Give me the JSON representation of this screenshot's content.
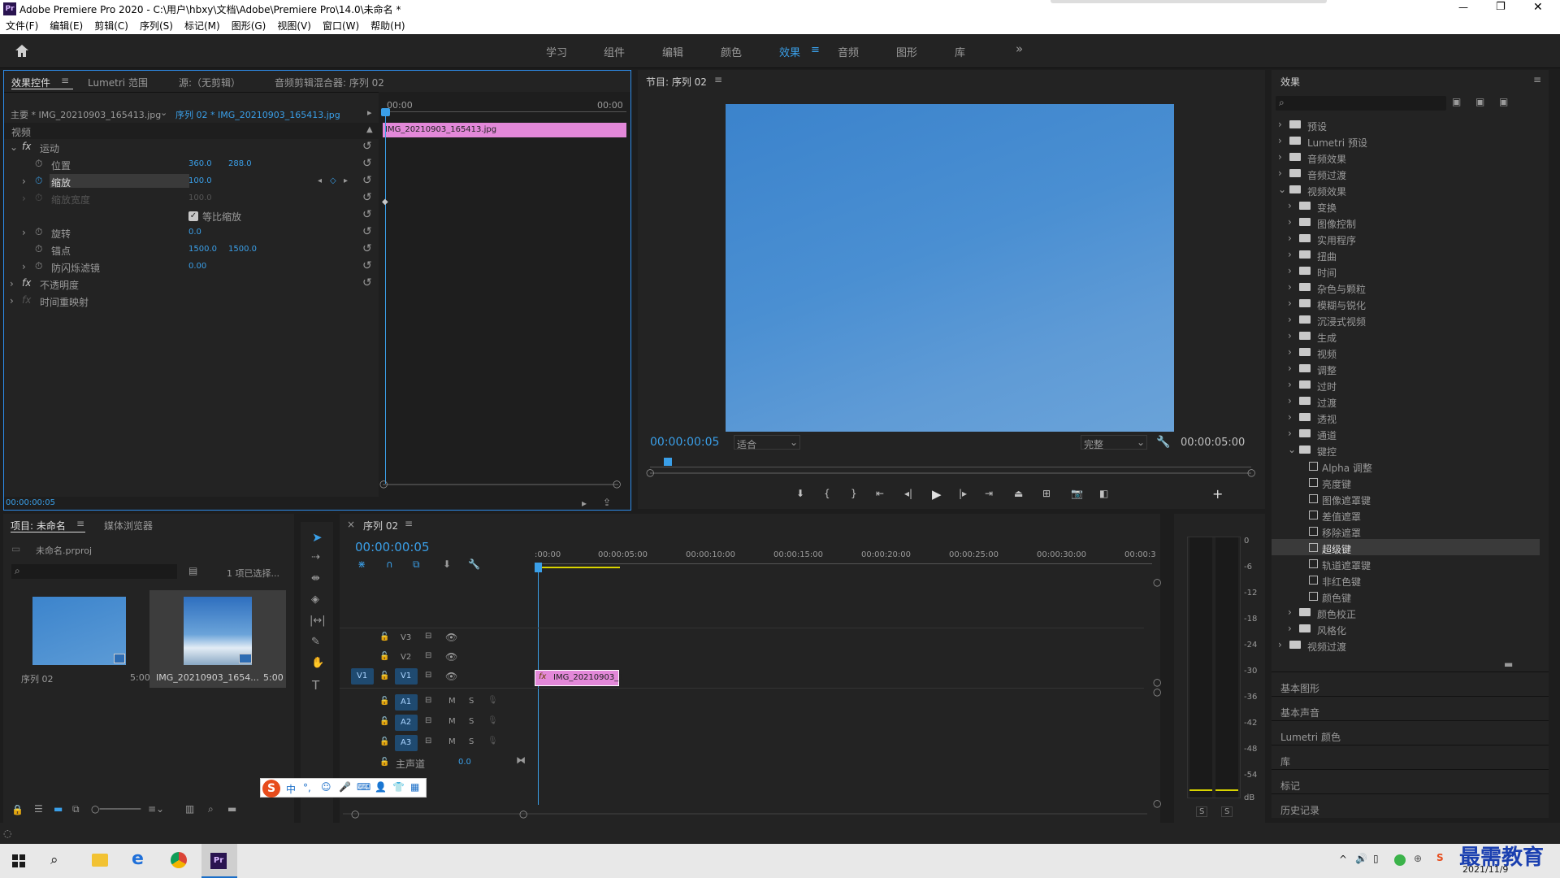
{
  "window": {
    "app_icon": "Pr",
    "title": "Adobe Premiere Pro 2020 - C:\\用户\\hbxy\\文档\\Adobe\\Premiere Pro\\14.0\\未命名 *",
    "min": "—",
    "max": "❐",
    "close": "✕"
  },
  "menu": [
    "文件(F)",
    "编辑(E)",
    "剪辑(C)",
    "序列(S)",
    "标记(M)",
    "图形(G)",
    "视图(V)",
    "窗口(W)",
    "帮助(H)"
  ],
  "workspaces": {
    "items": [
      "学习",
      "组件",
      "编辑",
      "颜色",
      "效果",
      "音频",
      "图形",
      "库"
    ],
    "active": "效果",
    "more": "»"
  },
  "effect_controls": {
    "tabs": [
      "效果控件",
      "Lumetri 范围",
      "源:（无剪辑）",
      "音频剪辑混合器: 序列 02"
    ],
    "master": "主要 * IMG_20210903_165413.jpg",
    "sequence_link": "序列 02 * IMG_20210903_165413.jpg",
    "time_start": "00:00",
    "time_end": "00:00",
    "clip_label": "IMG_20210903_165413.jpg",
    "section_video": "视频",
    "motion": "运动",
    "rows": [
      {
        "name": "位置",
        "v1": "360.0",
        "v2": "288.0"
      },
      {
        "name": "缩放",
        "v1": "100.0",
        "v2": ""
      },
      {
        "name": "缩放宽度",
        "v1": "100.0",
        "v2": ""
      },
      {
        "name": "旋转",
        "v1": "0.0",
        "v2": ""
      },
      {
        "name": "锚点",
        "v1": "1500.0",
        "v2": "1500.0"
      },
      {
        "name": "防闪烁滤镜",
        "v1": "0.00",
        "v2": ""
      }
    ],
    "uniform_scale": "等比缩放",
    "opacity": "不透明度",
    "time_remap": "时间重映射",
    "timecode": "00:00:00:05"
  },
  "program": {
    "title": "节目: 序列 02",
    "timecode": "00:00:00:05",
    "fit": "适合",
    "quality": "完整",
    "duration": "00:00:05:00",
    "frame_color": "#3d85cc"
  },
  "effects_panel": {
    "title": "效果",
    "search_placeholder": "",
    "tree": [
      {
        "label": "预设",
        "level": 0,
        "type": "folder",
        "open": false
      },
      {
        "label": "Lumetri 预设",
        "level": 0,
        "type": "folder",
        "open": false
      },
      {
        "label": "音频效果",
        "level": 0,
        "type": "folder",
        "open": false
      },
      {
        "label": "音频过渡",
        "level": 0,
        "type": "folder",
        "open": false
      },
      {
        "label": "视频效果",
        "level": 0,
        "type": "folder",
        "open": true
      },
      {
        "label": "变换",
        "level": 1,
        "type": "folder",
        "open": false
      },
      {
        "label": "图像控制",
        "level": 1,
        "type": "folder",
        "open": false
      },
      {
        "label": "实用程序",
        "level": 1,
        "type": "folder",
        "open": false
      },
      {
        "label": "扭曲",
        "level": 1,
        "type": "folder",
        "open": false
      },
      {
        "label": "时间",
        "level": 1,
        "type": "folder",
        "open": false
      },
      {
        "label": "杂色与颗粒",
        "level": 1,
        "type": "folder",
        "open": false
      },
      {
        "label": "模糊与锐化",
        "level": 1,
        "type": "folder",
        "open": false
      },
      {
        "label": "沉浸式视频",
        "level": 1,
        "type": "folder",
        "open": false
      },
      {
        "label": "生成",
        "level": 1,
        "type": "folder",
        "open": false
      },
      {
        "label": "视频",
        "level": 1,
        "type": "folder",
        "open": false
      },
      {
        "label": "调整",
        "level": 1,
        "type": "folder",
        "open": false
      },
      {
        "label": "过时",
        "level": 1,
        "type": "folder",
        "open": false
      },
      {
        "label": "过渡",
        "level": 1,
        "type": "folder",
        "open": false
      },
      {
        "label": "透视",
        "level": 1,
        "type": "folder",
        "open": false
      },
      {
        "label": "通道",
        "level": 1,
        "type": "folder",
        "open": false
      },
      {
        "label": "键控",
        "level": 1,
        "type": "folder",
        "open": true
      },
      {
        "label": "Alpha 调整",
        "level": 2,
        "type": "fx"
      },
      {
        "label": "亮度键",
        "level": 2,
        "type": "fx"
      },
      {
        "label": "图像遮罩键",
        "level": 2,
        "type": "fx"
      },
      {
        "label": "差值遮罩",
        "level": 2,
        "type": "fx"
      },
      {
        "label": "移除遮罩",
        "level": 2,
        "type": "fx"
      },
      {
        "label": "超级键",
        "level": 2,
        "type": "fx",
        "selected": true
      },
      {
        "label": "轨道遮罩键",
        "level": 2,
        "type": "fx"
      },
      {
        "label": "非红色键",
        "level": 2,
        "type": "fx"
      },
      {
        "label": "颜色键",
        "level": 2,
        "type": "fx"
      },
      {
        "label": "颜色校正",
        "level": 1,
        "type": "folder",
        "open": false
      },
      {
        "label": "风格化",
        "level": 1,
        "type": "folder",
        "open": false
      },
      {
        "label": "视频过渡",
        "level": 0,
        "type": "folder",
        "open": false
      }
    ],
    "collapsed_panels": [
      "基本图形",
      "基本声音",
      "Lumetri 颜色",
      "库",
      "标记",
      "历史记录"
    ]
  },
  "project": {
    "tabs": [
      "项目: 未命名",
      "媒体浏览器"
    ],
    "file": "未命名.prproj",
    "selection": "1 项已选择...",
    "items": [
      {
        "name": "序列 02",
        "dur": "5:00"
      },
      {
        "name": "IMG_20210903_1654...",
        "dur": "5:00"
      }
    ]
  },
  "timeline": {
    "tab": "序列 02",
    "timecode": "00:00:00:05",
    "ruler": [
      ":00:00",
      "00:00:05:00",
      "00:00:10:00",
      "00:00:15:00",
      "00:00:20:00",
      "00:00:25:00",
      "00:00:30:00",
      "00:00:3"
    ],
    "tracks_video": [
      "V3",
      "V2",
      "V1"
    ],
    "tracks_audio": [
      "A1",
      "A2",
      "A3"
    ],
    "src_v": "V1",
    "master": "主声道",
    "master_val": "0.0",
    "clip": "IMG_20210903_1",
    "m": "M",
    "s": "S"
  },
  "meter": {
    "scale": [
      "0",
      "-6",
      "-12",
      "-18",
      "-24",
      "-30",
      "-36",
      "-42",
      "-48",
      "-54",
      "dB"
    ],
    "solo": [
      "S",
      "S"
    ]
  },
  "ime": {
    "items": [
      "S",
      "中",
      "°,",
      "☺",
      "🎤",
      "⌨",
      "👤",
      "👕",
      "▦"
    ]
  },
  "taskbar": {
    "clock": "2021/11/9",
    "watermark": "最需教育"
  }
}
